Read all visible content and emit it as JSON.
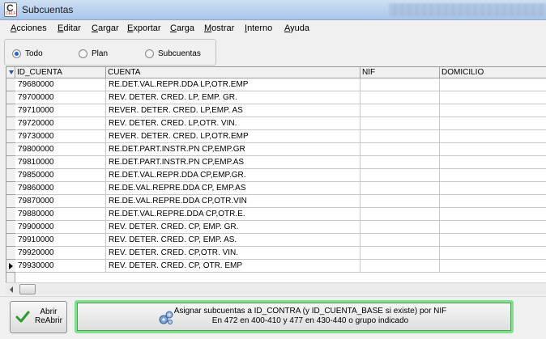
{
  "window": {
    "title": "Subcuentas",
    "app_icon_letter": "C",
    "app_icon_sub": "DELFI"
  },
  "menu": [
    {
      "label": "Acciones",
      "u": "A",
      "rest": "cciones"
    },
    {
      "label": "Editar",
      "u": "E",
      "rest": "ditar"
    },
    {
      "label": "Cargar",
      "u": "C",
      "rest": "argar"
    },
    {
      "label": "Exportar",
      "u": "E",
      "rest": "xportar"
    },
    {
      "label": "Carga",
      "u": "C",
      "rest": "arga"
    },
    {
      "label": "Mostrar",
      "u": "M",
      "rest": "ostrar"
    },
    {
      "label": "Interno",
      "u": "I",
      "rest": "nterno"
    },
    {
      "label": "Ayuda",
      "u": "A",
      "rest": "yuda"
    }
  ],
  "filter": {
    "options": [
      "Todo",
      "Plan",
      "Subcuentas"
    ],
    "selected": "Todo"
  },
  "grid": {
    "columns": [
      "ID_CUENTA",
      "CUENTA",
      "NIF",
      "DOMICILIO"
    ],
    "current_row": 15,
    "rows": [
      [
        "79680000",
        "RE.DET.VAL.REPR.DDA LP,OTR.EMP",
        "",
        ""
      ],
      [
        "79700000",
        "REV. DETER. CRED. LP, EMP. GR.",
        "",
        ""
      ],
      [
        "79710000",
        "REVER. DETER. CRED. LP,EMP. AS",
        "",
        ""
      ],
      [
        "79720000",
        "REV. DETER. CRED. LP,OTR. VIN.",
        "",
        ""
      ],
      [
        "79730000",
        "REVER. DETER. CRED. LP,OTR.EMP",
        "",
        ""
      ],
      [
        "79800000",
        "RE.DET.PART.INSTR.PN CP,EMP.GR",
        "",
        ""
      ],
      [
        "79810000",
        "RE.DET.PART.INSTR.PN CP,EMP.AS",
        "",
        ""
      ],
      [
        "79850000",
        "RE.DET.VAL.REPR.DDA CP,EMP.GR.",
        "",
        ""
      ],
      [
        "79860000",
        "RE.DE.VAL.REPRE.DDA CP, EMP.AS",
        "",
        ""
      ],
      [
        "79870000",
        "RE.DE.VAL.REPRE.DDA CP,OTR.VIN",
        "",
        ""
      ],
      [
        "79880000",
        "RE.DET.VAL.REPRE.DDA CP,OTR.E.",
        "",
        ""
      ],
      [
        "79900000",
        "REV. DETER. CRED. CP, EMP. GR.",
        "",
        ""
      ],
      [
        "79910000",
        "REV. DETER. CRED. CP, EMP. AS.",
        "",
        ""
      ],
      [
        "79920000",
        "REV. DETER. CRED. CP,OTR. VIN.",
        "",
        ""
      ],
      [
        "79930000",
        "REV. DETER. CRED. CP, OTR. EMP",
        "",
        ""
      ]
    ]
  },
  "buttons": {
    "abrir_line1": "Abrir",
    "abrir_line2": "ReAbrir",
    "asignar_line1": "Asignar subcuentas a ID_CONTRA (y ID_CUENTA_BASE si existe) por NIF",
    "asignar_line2": "En 472 en 400-410 y 477 en 430-440 o grupo indicado"
  },
  "colors": {
    "accent_border": "#7fe08a",
    "radio_selected": "#2a63c9"
  }
}
